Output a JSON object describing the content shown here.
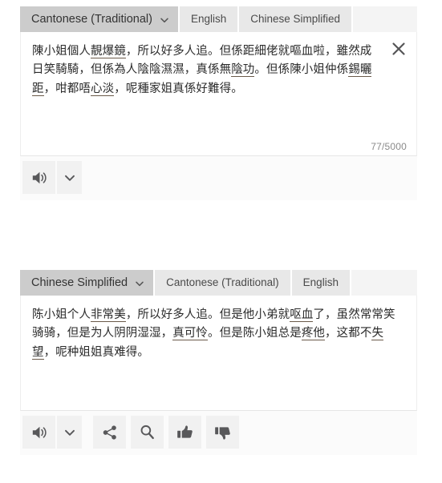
{
  "source_panel": {
    "tabs": [
      {
        "label": "Cantonese (Traditional)",
        "active": true,
        "has_caret": true
      },
      {
        "label": "English",
        "active": false,
        "has_caret": false
      },
      {
        "label": "Chinese Simplified",
        "active": false,
        "has_caret": false
      }
    ],
    "text_segments": [
      {
        "t": "陳小姐個人",
        "u": false
      },
      {
        "t": "靚爆鏡",
        "u": true
      },
      {
        "t": "，所以好多人追。但係距細佬就嘔血啦，雖然成日笑騎騎，但係為人陰陰濕濕，真係無",
        "u": false
      },
      {
        "t": "陰功",
        "u": true
      },
      {
        "t": "。但係陳小姐仲係",
        "u": false
      },
      {
        "t": "錫曬距",
        "u": true
      },
      {
        "t": "，咁都唔",
        "u": false
      },
      {
        "t": "心淡",
        "u": true
      },
      {
        "t": "，呢種家姐真係好難得。",
        "u": false
      }
    ],
    "char_counter": "77/5000",
    "close_icon": "close-icon",
    "buttons": [
      {
        "name": "listen-source-button",
        "icon": "speaker-icon"
      },
      {
        "name": "source-options-button",
        "icon": "chevron-down-icon"
      }
    ]
  },
  "target_panel": {
    "tabs": [
      {
        "label": "Chinese Simplified",
        "active": true,
        "has_caret": true
      },
      {
        "label": "Cantonese (Traditional)",
        "active": false,
        "has_caret": false
      },
      {
        "label": "English",
        "active": false,
        "has_caret": false
      }
    ],
    "text_segments": [
      {
        "t": "陈小姐个人",
        "u": false
      },
      {
        "t": "非常美",
        "u": true
      },
      {
        "t": "，所以好多人追。但是他小弟就",
        "u": false
      },
      {
        "t": "呕血",
        "u": true
      },
      {
        "t": "了，虽然常常笑骑骑，但是为人阴阴湿湿，",
        "u": false
      },
      {
        "t": "真可怜",
        "u": true
      },
      {
        "t": "。但是陈小姐总是",
        "u": false
      },
      {
        "t": "疼他",
        "u": true
      },
      {
        "t": "，这都不",
        "u": false
      },
      {
        "t": "失望",
        "u": true
      },
      {
        "t": "，呢种姐姐真难得。",
        "u": false
      }
    ],
    "buttons": [
      {
        "name": "listen-translation-button",
        "icon": "speaker-icon"
      },
      {
        "name": "translation-options-button",
        "icon": "chevron-down-icon"
      },
      {
        "name": "share-button",
        "icon": "share-icon"
      },
      {
        "name": "lookup-button",
        "icon": "magnifier-icon"
      },
      {
        "name": "thumbs-up-button",
        "icon": "thumbs-up-icon"
      },
      {
        "name": "thumbs-down-button",
        "icon": "thumbs-down-icon"
      }
    ]
  },
  "colors": {
    "active_tab": "#cccccc",
    "inactive_tab": "#e8e8e8",
    "panel_bg": "#fbfbfb",
    "icon": "#58585a",
    "underline": "#6b5a4a"
  }
}
